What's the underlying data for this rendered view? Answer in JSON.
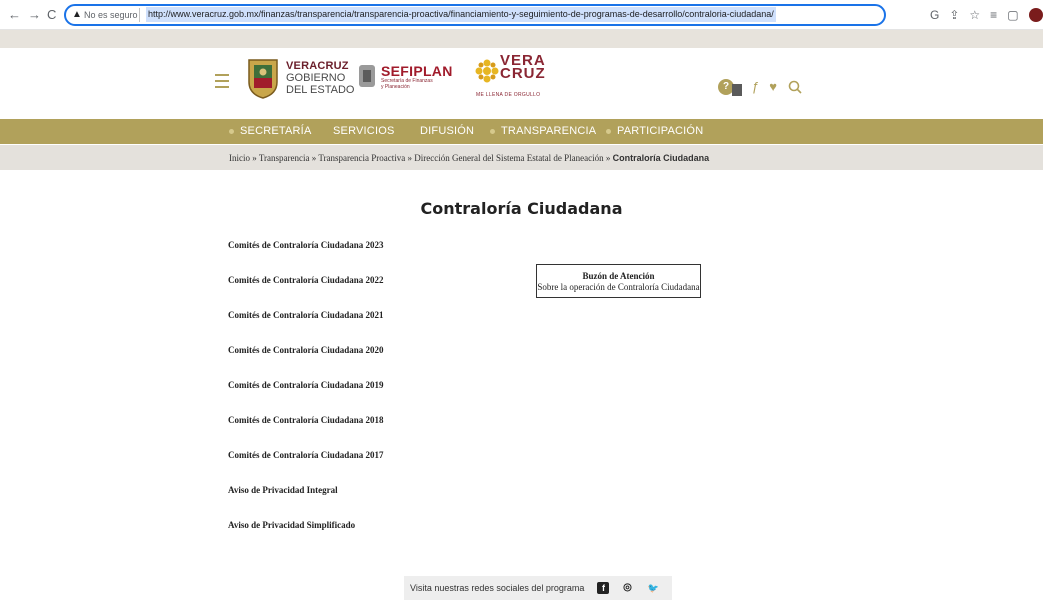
{
  "browser": {
    "back": "←",
    "forward": "→",
    "reload": "C",
    "security_label": "No es seguro",
    "url": "http://www.veracruz.gob.mx/finanzas/transparencia/transparencia-proactiva/financiamiento-y-seguimiento-de-programas-de-desarrollo/contraloria-ciudadana/",
    "icons": [
      "google-icon",
      "share-icon",
      "star-icon",
      "reading-list-icon",
      "tab-icon",
      "profile-icon"
    ]
  },
  "header": {
    "logo_line1": "VERACRUZ",
    "logo_line2": "GOBIERNO",
    "logo_line3": "DEL ESTADO",
    "sefiplan_title": "SEFIPLAN",
    "sefiplan_sub1": "Secretaría de Finanzas",
    "sefiplan_sub2": "y Planeación",
    "vera_line1": "VERA",
    "vera_line2": "CRUZ",
    "vera_slogan": "ME LLENA DE ORGULLO",
    "help_glyph": "?"
  },
  "nav": {
    "items": [
      "SECRETARÍA",
      "SERVICIOS",
      "DIFUSIÓN",
      "TRANSPARENCIA",
      "PARTICIPACIÓN"
    ]
  },
  "breadcrumb": {
    "items": [
      "Inicio",
      "Transparencia",
      "Transparencia Proactiva",
      "Dirección General del Sistema Estatal de Planeación"
    ],
    "separator": "»",
    "current": "Contraloría Ciudadana"
  },
  "main": {
    "title": "Contraloría Ciudadana",
    "links": [
      "Comités de Contraloría Ciudadana 2023",
      "Comités de Contraloría Ciudadana 2022",
      "Comités de Contraloría Ciudadana 2021",
      "Comités de Contraloría Ciudadana 2020",
      "Comités de Contraloría Ciudadana 2019",
      "Comités de Contraloría Ciudadana 2018",
      "Comités de Contraloría Ciudadana 2017",
      "Aviso de Privacidad Integral",
      "Aviso de Privacidad Simplificado"
    ],
    "buzon_title": "Buzón de Atención",
    "buzon_subtitle": "Sobre la operación de Contraloría Ciudadana"
  },
  "footer": {
    "social_text": "Visita nuestras redes sociales del programa",
    "facebook_glyph": "f",
    "instagram_glyph": "◎",
    "twitter_glyph": "🐦"
  },
  "colors": {
    "brand_gold": "#b1a15b",
    "brand_maroon": "#8a2633",
    "breadcrumb_bg": "#e4e1dc"
  }
}
